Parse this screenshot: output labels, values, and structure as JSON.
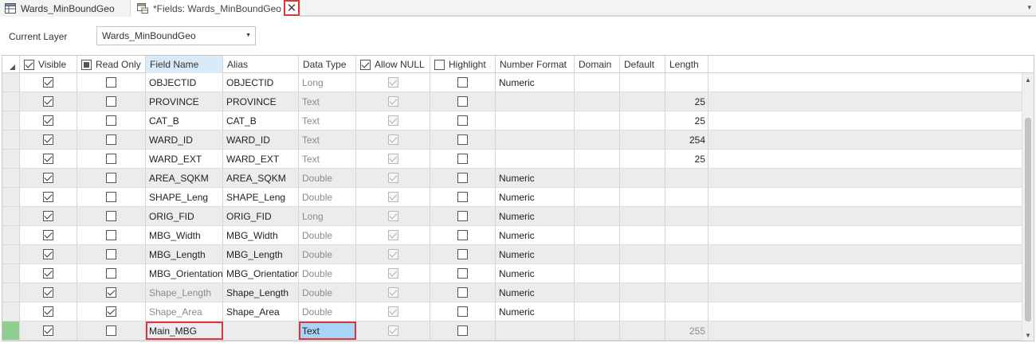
{
  "tabs": [
    {
      "label": "Wards_MinBoundGeo",
      "icon": "table-icon"
    },
    {
      "label": "*Fields:  Wards_MinBoundGeo",
      "icon": "fields-view-icon",
      "close_glyph": "✕"
    }
  ],
  "menu_chevron": "▾",
  "layer": {
    "label": "Current Layer",
    "value": "Wards_MinBoundGeo",
    "dropdown_glyph": "▼"
  },
  "columns": [
    "Visible",
    "Read Only",
    "Field Name",
    "Alias",
    "Data Type",
    "Allow NULL",
    "Highlight",
    "Number Format",
    "Domain",
    "Default",
    "Length"
  ],
  "header_checks": {
    "visible": "checked",
    "read_only": "filled",
    "allow_null": "checked",
    "highlight": "unchecked"
  },
  "rows": [
    {
      "visible": true,
      "read_only": false,
      "field_name": "OBJECTID",
      "alias": "OBJECTID",
      "data_type": "Long",
      "allow_null": true,
      "highlight": false,
      "number_format": "Numeric",
      "domain": "",
      "default": "",
      "length": "",
      "shade": "white"
    },
    {
      "visible": true,
      "read_only": false,
      "field_name": "PROVINCE",
      "alias": "PROVINCE",
      "data_type": "Text",
      "allow_null": true,
      "highlight": false,
      "number_format": "",
      "domain": "",
      "default": "",
      "length": "25",
      "shade": "alt"
    },
    {
      "visible": true,
      "read_only": false,
      "field_name": "CAT_B",
      "alias": "CAT_B",
      "data_type": "Text",
      "allow_null": true,
      "highlight": false,
      "number_format": "",
      "domain": "",
      "default": "",
      "length": "25",
      "shade": "white"
    },
    {
      "visible": true,
      "read_only": false,
      "field_name": "WARD_ID",
      "alias": "WARD_ID",
      "data_type": "Text",
      "allow_null": true,
      "highlight": false,
      "number_format": "",
      "domain": "",
      "default": "",
      "length": "254",
      "shade": "alt"
    },
    {
      "visible": true,
      "read_only": false,
      "field_name": "WARD_EXT",
      "alias": "WARD_EXT",
      "data_type": "Text",
      "allow_null": true,
      "highlight": false,
      "number_format": "",
      "domain": "",
      "default": "",
      "length": "25",
      "shade": "white"
    },
    {
      "visible": true,
      "read_only": false,
      "field_name": "AREA_SQKM",
      "alias": "AREA_SQKM",
      "data_type": "Double",
      "allow_null": true,
      "highlight": false,
      "number_format": "Numeric",
      "domain": "",
      "default": "",
      "length": "",
      "shade": "alt"
    },
    {
      "visible": true,
      "read_only": false,
      "field_name": "SHAPE_Leng",
      "alias": "SHAPE_Leng",
      "data_type": "Double",
      "allow_null": true,
      "highlight": false,
      "number_format": "Numeric",
      "domain": "",
      "default": "",
      "length": "",
      "shade": "white"
    },
    {
      "visible": true,
      "read_only": false,
      "field_name": "ORIG_FID",
      "alias": "ORIG_FID",
      "data_type": "Long",
      "allow_null": true,
      "highlight": false,
      "number_format": "Numeric",
      "domain": "",
      "default": "",
      "length": "",
      "shade": "alt"
    },
    {
      "visible": true,
      "read_only": false,
      "field_name": "MBG_Width",
      "alias": "MBG_Width",
      "data_type": "Double",
      "allow_null": true,
      "highlight": false,
      "number_format": "Numeric",
      "domain": "",
      "default": "",
      "length": "",
      "shade": "white"
    },
    {
      "visible": true,
      "read_only": false,
      "field_name": "MBG_Length",
      "alias": "MBG_Length",
      "data_type": "Double",
      "allow_null": true,
      "highlight": false,
      "number_format": "Numeric",
      "domain": "",
      "default": "",
      "length": "",
      "shade": "alt"
    },
    {
      "visible": true,
      "read_only": false,
      "field_name": "MBG_Orientation",
      "alias": "MBG_Orientation",
      "data_type": "Double",
      "allow_null": true,
      "highlight": false,
      "number_format": "Numeric",
      "domain": "",
      "default": "",
      "length": "",
      "shade": "white"
    },
    {
      "visible": true,
      "read_only": true,
      "field_name": "Shape_Length",
      "alias": "Shape_Length",
      "data_type": "Double",
      "allow_null": true,
      "highlight": false,
      "number_format": "Numeric",
      "domain": "",
      "default": "",
      "length": "",
      "shade": "alt",
      "field_grey": true
    },
    {
      "visible": true,
      "read_only": true,
      "field_name": "Shape_Area",
      "alias": "Shape_Area",
      "data_type": "Double",
      "allow_null": true,
      "highlight": false,
      "number_format": "Numeric",
      "domain": "",
      "default": "",
      "length": "",
      "shade": "white",
      "field_grey": true
    },
    {
      "visible": true,
      "read_only": false,
      "field_name": "Main_MBG",
      "alias": "",
      "data_type": "Text",
      "allow_null": true,
      "highlight": false,
      "number_format": "",
      "domain": "",
      "default": "",
      "length": "255",
      "shade": "alt",
      "new_row": true
    }
  ],
  "scroll": {
    "up_glyph": "▲",
    "down_glyph": "▼"
  },
  "colors": {
    "highlight_red": "#d9353c",
    "new_row_green": "#8fce8f",
    "selected_cell_blue": "#a8d4f7",
    "header_selected": "#d9ebf9"
  }
}
